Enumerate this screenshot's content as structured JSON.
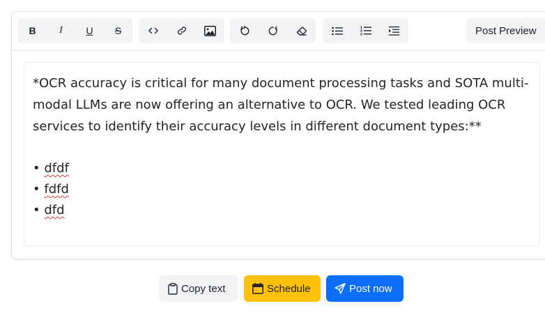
{
  "toolbar": {
    "groups": [
      {
        "name": "text-format",
        "buttons": [
          {
            "icon": "bold-icon",
            "label": "B"
          },
          {
            "icon": "italic-icon",
            "label": "I"
          },
          {
            "icon": "underline-icon",
            "label": "U"
          },
          {
            "icon": "strikethrough-icon",
            "label": "S"
          }
        ]
      },
      {
        "name": "insert",
        "buttons": [
          {
            "icon": "code-icon"
          },
          {
            "icon": "link-icon"
          },
          {
            "icon": "image-icon"
          }
        ]
      },
      {
        "name": "history",
        "buttons": [
          {
            "icon": "undo-icon"
          },
          {
            "icon": "redo-icon"
          },
          {
            "icon": "eraser-icon"
          }
        ]
      },
      {
        "name": "lists",
        "buttons": [
          {
            "icon": "bullet-list-icon"
          },
          {
            "icon": "numbered-list-icon"
          },
          {
            "icon": "indent-icon"
          }
        ]
      }
    ],
    "preview_label": "Post Preview"
  },
  "editor": {
    "paragraph": "*OCR accuracy is critical for many document processing tasks and SOTA multi-modal LLMs are now offering an alternative to OCR. We tested leading OCR services to identify their accuracy levels in different document types:**",
    "bullet_marker": "•",
    "bullets": [
      "dfdf",
      "fdfd",
      "dfd"
    ]
  },
  "actions": {
    "copy_label": "Copy text",
    "schedule_label": "Schedule",
    "post_label": "Post now"
  },
  "colors": {
    "schedule": "#ffc107",
    "post": "#0d6efd",
    "toolbar_bg": "#f1f3f5",
    "spell_error": "#e03131"
  }
}
